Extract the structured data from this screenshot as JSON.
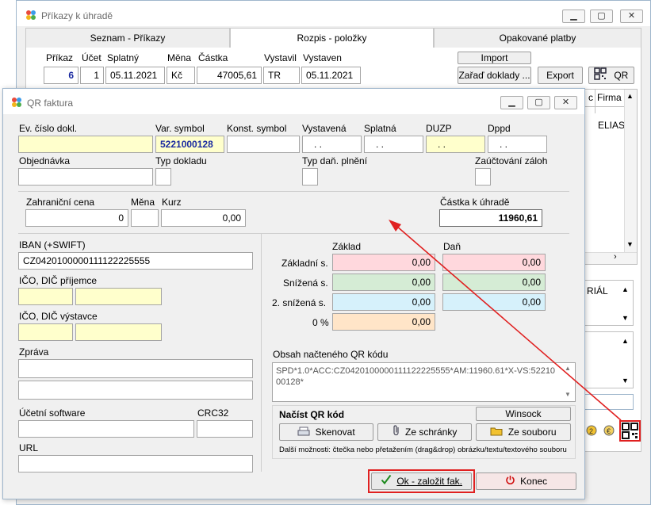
{
  "colors": {
    "accent_red": "#e02020",
    "arrow": "#e02020",
    "field_yellow": "#ffffcc",
    "field_pink": "#ffd8dd",
    "field_green": "#d5ecd5",
    "field_blue": "#d6f1fb",
    "field_orange": "#ffe5c8"
  },
  "back_window": {
    "title": "Příkazy k úhradě",
    "tabs": [
      {
        "label": "Seznam - Příkazy"
      },
      {
        "label": "Rozpis - položky"
      },
      {
        "label": "Opakované platby"
      }
    ],
    "columns": {
      "prikaz": "Příkaz",
      "ucet": "Účet",
      "splatny": "Splatný",
      "mena": "Měna",
      "castka": "Částka",
      "vystavil": "Vystavil",
      "vystaven": "Vystaven"
    },
    "row": {
      "prikaz": "6",
      "ucet": "1",
      "splatny": "05.11.2021",
      "mena": "Kč",
      "castka": "47005,61",
      "vystavil": "TR",
      "vystaven": "05.11.2021"
    },
    "buttons": {
      "import": "Import",
      "zarad": "Zařaď doklady ...",
      "export": "Export",
      "qr": "QR"
    },
    "grid_headers": {
      "c": "c",
      "firma": "Firma"
    },
    "grid_value": "ELIAS",
    "side_text": "RIÁL"
  },
  "qr_dialog": {
    "title": "QR faktura",
    "labels": {
      "ev_cislo": "Ev. číslo dokl.",
      "var_symbol": "Var. symbol",
      "konst_symbol": "Konst. symbol",
      "vystavena": "Vystavená",
      "splatna": "Splatná",
      "duzp": "DUZP",
      "dppd": "Dppd",
      "objednavka": "Objednávka",
      "typ_dokladu": "Typ dokladu",
      "typ_dan": "Typ daň. plnění",
      "zauctovani": "Zaúčtování záloh",
      "zahranicni": "Zahraniční cena",
      "mena": "Měna",
      "kurz": "Kurz",
      "castka_k_uhrade": "Částka k úhradě",
      "iban": "IBAN (+SWIFT)",
      "ico_prijemce": "IČO, DIČ příjemce",
      "ico_vystavce": "IČO, DIČ výstavce",
      "zprava": "Zpráva",
      "ucetni_software": "Účetní software",
      "crc32": "CRC32",
      "url": "URL",
      "zaklad": "Základ",
      "dan": "Daň",
      "zakladni_s": "Základní s.",
      "snizena_s": "Snížená s.",
      "snizena2_s": "2. snížená s.",
      "nula": "0 %",
      "obsah_qr": "Obsah načteného QR kódu",
      "nacist_qr": "Načíst QR kód",
      "dalsi_moznosti": "Další možnosti: čtečka nebo přetažením (drag&drop) obrázku/textu/textového souboru"
    },
    "values": {
      "var_symbol": "5221000128",
      "vystavena": ". .",
      "splatna": ". .",
      "duzp": ". .",
      "dppd": ". .",
      "zahranicni_cena": "0",
      "kurz": "0,00",
      "castka_k_uhrade": "11960,61",
      "iban": "CZ0420100000111122225555",
      "zakladni_zaklad": "0,00",
      "zakladni_dan": "0,00",
      "snizena_zaklad": "0,00",
      "snizena_dan": "0,00",
      "snizena2_zaklad": "0,00",
      "snizena2_dan": "0,00",
      "nula_zaklad": "0,00",
      "qr_content": "SPD*1.0*ACC:CZ0420100000111122225555*AM:11960.61*X-VS:5221000128*"
    },
    "buttons": {
      "winsock": "Winsock",
      "skenovat": "Skenovat",
      "ze_schranky": "Ze schránky",
      "ze_souboru": "Ze souboru",
      "ok": "Ok - založit fak.",
      "konec": "Konec"
    }
  }
}
